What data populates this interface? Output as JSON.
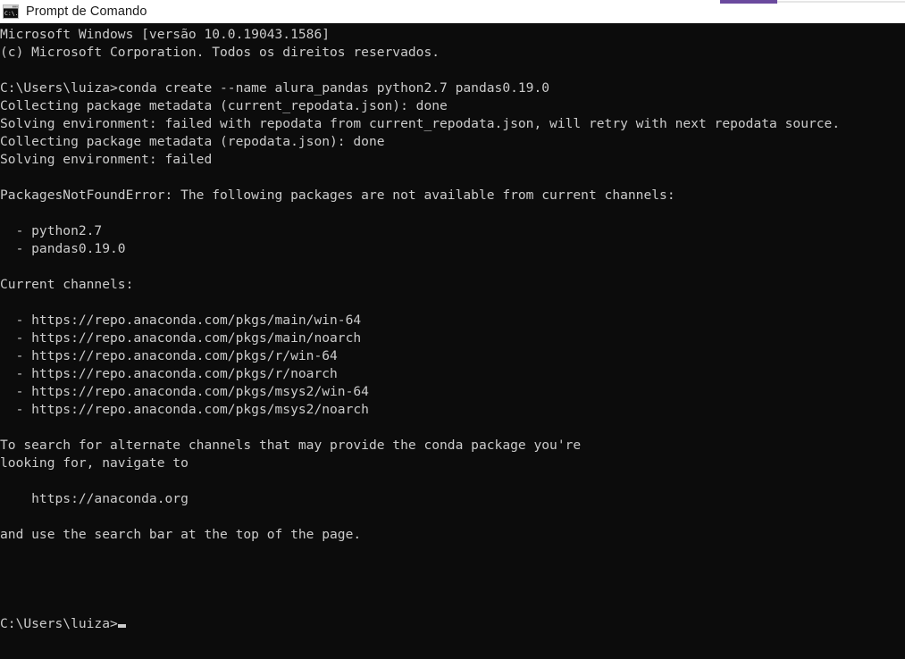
{
  "window": {
    "title": "Prompt de Comando",
    "icon": "cmd-console-icon",
    "titlebar_bg": "#ffffff",
    "title_color": "#1a1a1a"
  },
  "accent": {
    "bar_color": "#6b4a9e",
    "rail_color": "#e6e6e6"
  },
  "terminal": {
    "background": "#0c0c0c",
    "foreground": "#cccccc",
    "lines": [
      "Microsoft Windows [versão 10.0.19043.1586]",
      "(c) Microsoft Corporation. Todos os direitos reservados.",
      "",
      "C:\\Users\\luiza>conda create --name alura_pandas python2.7 pandas0.19.0",
      "Collecting package metadata (current_repodata.json): done",
      "Solving environment: failed with repodata from current_repodata.json, will retry with next repodata source.",
      "Collecting package metadata (repodata.json): done",
      "Solving environment: failed",
      "",
      "PackagesNotFoundError: The following packages are not available from current channels:",
      "",
      "  - python2.7",
      "  - pandas0.19.0",
      "",
      "Current channels:",
      "",
      "  - https://repo.anaconda.com/pkgs/main/win-64",
      "  - https://repo.anaconda.com/pkgs/main/noarch",
      "  - https://repo.anaconda.com/pkgs/r/win-64",
      "  - https://repo.anaconda.com/pkgs/r/noarch",
      "  - https://repo.anaconda.com/pkgs/msys2/win-64",
      "  - https://repo.anaconda.com/pkgs/msys2/noarch",
      "",
      "To search for alternate channels that may provide the conda package you're",
      "looking for, navigate to",
      "",
      "    https://anaconda.org",
      "",
      "and use the search bar at the top of the page.",
      "",
      "",
      "",
      ""
    ],
    "prompt": "C:\\Users\\luiza>",
    "cursor_visible": true
  }
}
